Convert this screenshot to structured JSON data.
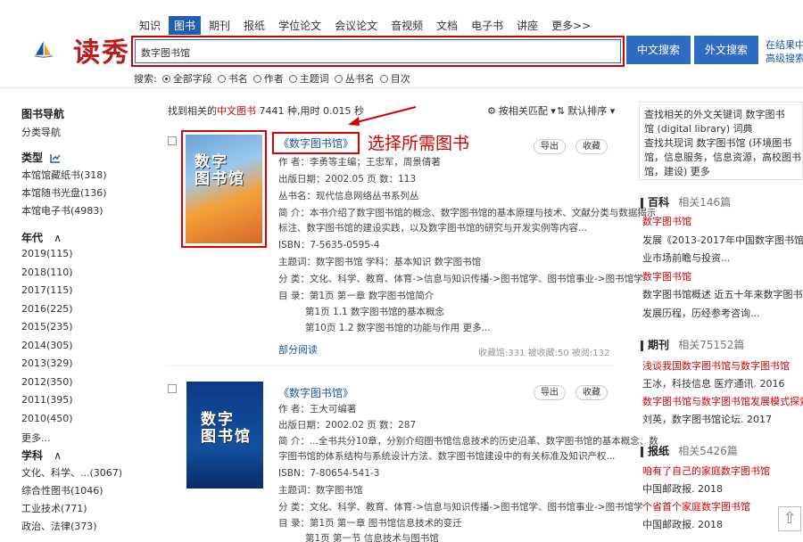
{
  "brand": {
    "logo_text": "读秀",
    "logo_icon": "sailboat-logo-icon"
  },
  "nav": [
    "知识",
    "图书",
    "期刊",
    "报纸",
    "学位论文",
    "会议论文",
    "音视频",
    "文档",
    "电子书",
    "讲座",
    "更多>>"
  ],
  "nav_active": 1,
  "search": {
    "value": "数字图书馆",
    "btn_cn": "中文搜索",
    "btn_en": "外文搜索",
    "adv1": "在结果中搜",
    "adv2": "高级搜索"
  },
  "scope": {
    "label": "搜索:",
    "options": [
      "全部字段",
      "书名",
      "作者",
      "主题词",
      "丛书名",
      "目次"
    ],
    "selected": 0
  },
  "sidebar": {
    "nav_title": "图书导航",
    "nav_item": "分类导航",
    "type_title": "类型",
    "types": [
      "本馆馆藏纸书(318)",
      "本馆随书光盘(136)",
      "本馆电子书(4983)"
    ],
    "year_title": "年代",
    "years": [
      "2019(115)",
      "2018(110)",
      "2017(115)",
      "2016(225)",
      "2015(235)",
      "2014(305)",
      "2013(329)",
      "2012(350)",
      "2011(395)",
      "2010(450)",
      "更多..."
    ],
    "subject_title": "学科",
    "subjects": [
      "文化、科学、...(3067)",
      "综合性图书(1046)",
      "工业技术(771)",
      "政治、法律(373)"
    ]
  },
  "results": {
    "prefix": "找到相关的",
    "kind": "中文图书",
    "count": "7441",
    "suffix": " 种,用时 0.015 秒",
    "sort_match": "按相关匹配 ▾",
    "sort_default": "默认排序 ▾"
  },
  "annotation": "选择所需图书",
  "book1": {
    "title": "《数字图书馆》",
    "cover_title": "数字\n图书馆",
    "author": "作 者：李勇等主编；王忠军，周景倩著",
    "date_pages": "出版日期：2002.05      页 数：113",
    "series": "丛书名：现代信息网络丛书系列丛",
    "summary1": "简 介：本书介绍了数字图书馆的概念、数字图书馆的基本原理与技术、文献分类与数据揭示",
    "summary2": "标注、数字图书馆的建设实践，以及数字图书馆的研究与开发实例等内容...",
    "isbn": "ISBN：7-5635-0595-4",
    "subject": "主题词：数字图书馆 学科：基本知识 数字图书馆",
    "class": "分 类：文化、科学、教育、体育->信息与知识传播->图书馆学、图书馆事业->图书馆学",
    "toc1": "目 录：第1页 第一章 数字图书馆简介",
    "toc2": "第1页 1.1 数字图书馆的基本概念",
    "toc3": "第10页 1.2 数字图书馆的功能与作用 更多...",
    "read": "部分阅读",
    "stats": "收藏馆:331    被收藏:50    被阅:132",
    "btn_export": "导出",
    "btn_fav": "收藏"
  },
  "book2": {
    "title": "《数字图书馆》",
    "cover_title": "数字\n图书馆",
    "author": "作 者：王大可编著",
    "date_pages": "出版日期：2002.02      页 数：287",
    "summary1": "简 介：...全书共分10章，分别介绍图书馆信息技术的历史沿革、数字图书馆的基本概念、数",
    "summary2": "字图书馆的体系结构与系统设计方法、数字图书馆建设中的有关标准及知识产权...",
    "isbn": "ISBN：7-80654-541-3",
    "subject": "主题词：数字图书馆",
    "class": "分 类：文化、科学、教育、体育->信息与知识传播->图书馆学、图书馆事业->图书馆学",
    "toc1": "目 录：第1页 第一章 图书馆信息技术的变迁",
    "toc2": "第1页 第一节 信息技术与图书馆",
    "btn_export": "导出",
    "btn_fav": "收藏"
  },
  "right": {
    "box1_line1": "查找相关的外文关键词 数字图书",
    "box1_line2": "馆 (digital library) 词典",
    "box1_line3": "查找共现词 数字图书馆 (环境图书",
    "box1_line4": "馆，信息服务，信息资源，高校图书",
    "box1_line5": "馆，建设) 更多",
    "baike_title": "百科",
    "baike_count": "相关146篇",
    "baike_items": [
      "数字图书馆",
      "发展《2013-2017年中国数字图书馆行",
      "业市场前瞻与投资...",
      "数字图书馆",
      "数字图书馆概述      近五十年来数字图书馆的",
      "发展历程，历经参考咨询..."
    ],
    "journal_title": "期刊",
    "journal_count": "相关75152篇",
    "journal_items": [
      "浅谈我国数字图书馆与数字图书馆",
      "王冰，科技信息 医疗通讯. 2016",
      "数字图书馆与数字图书馆发展模式探索",
      "刘英，数字图书馆论坛. 2017"
    ],
    "paper_title": "报纸",
    "paper_count": "相关5426篇",
    "paper_items": [
      "咱有了自己的家庭数字图书馆",
      "中国邮政报. 2018",
      "个省首个家庭数字图书馆",
      "中国邮政报. 2018"
    ]
  }
}
